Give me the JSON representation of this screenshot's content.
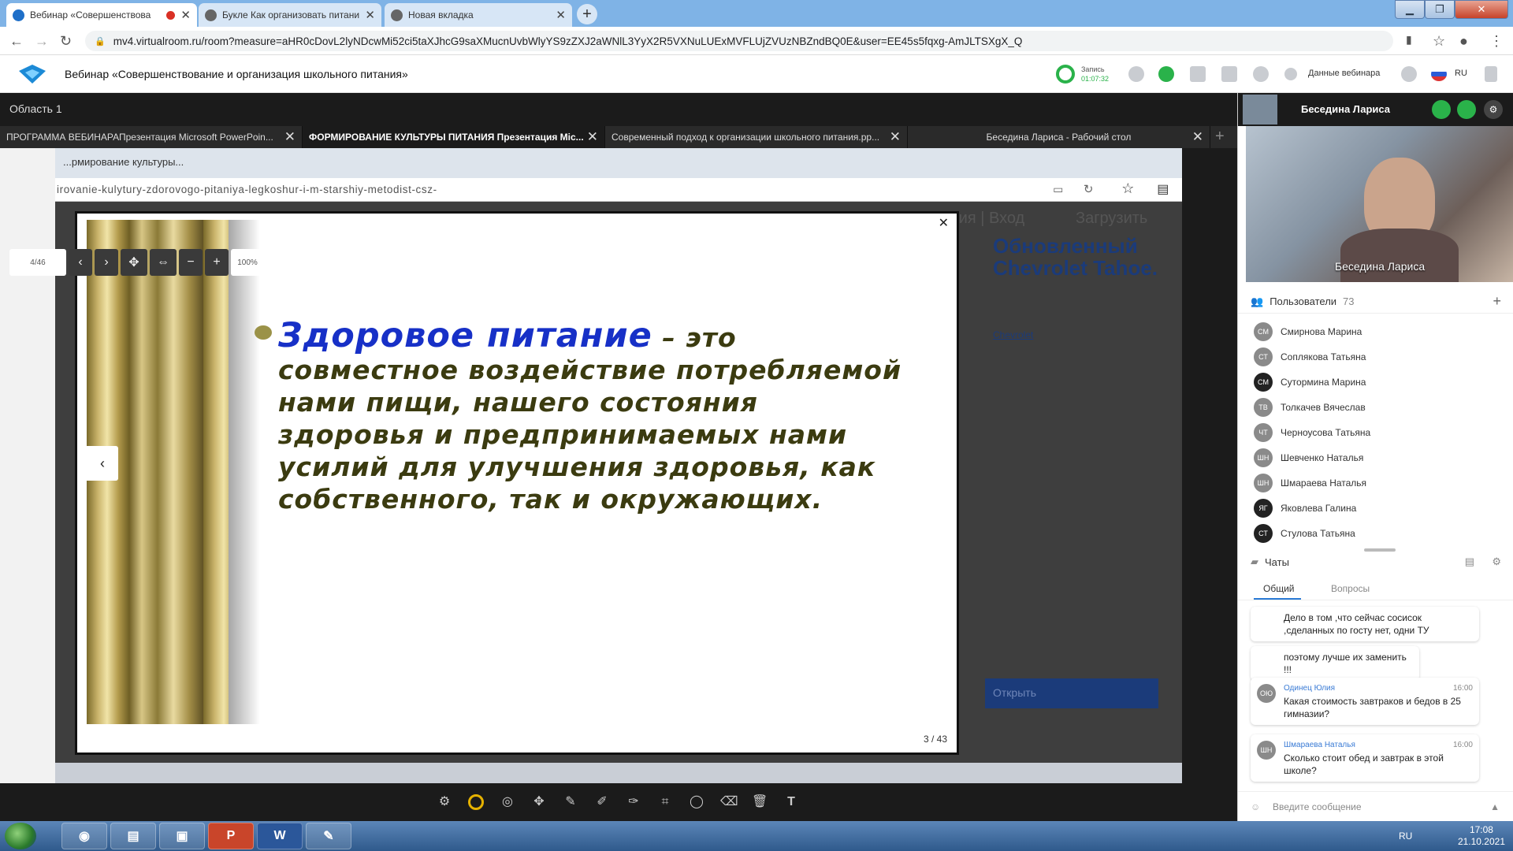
{
  "browser": {
    "tabs": [
      {
        "title": "Вебинар «Совершенствова",
        "recording": true
      },
      {
        "title": "Букле Как организовать питани"
      },
      {
        "title": "Новая вкладка"
      }
    ],
    "url": "mv4.virtualroom.ru/room?measure=aHR0cDovL2lyNDcwMi52ci5taXJhcG9saXMucnUvbWlyYS9zZXJ2aWNlL3YyX2R5VXNuLUExMVFLUjZVUzNBZndBQ0E&user=EE45s5fqxg-AmJLTSXgX_Q"
  },
  "app": {
    "title": "Вебинар «Совершенствование и организация школьного питания»",
    "record_label": "Запись",
    "record_time": "01:07:32",
    "webinar_data_label": "Данные вебинара",
    "lang": "RU"
  },
  "stage": {
    "region": "Область 1",
    "doc_tabs": [
      {
        "label": "ПРОГРАММА ВЕБИНАРАПрезентация Microsoft PowerPoin..."
      },
      {
        "label": "ФОРМИРОВАНИЕ КУЛЬТУРЫ ПИТАНИЯ Презентация Mic...",
        "active": true
      },
      {
        "label": "Современный подход к организации школьного питания.pp..."
      },
      {
        "label": "Беседина Лариса - Рабочий стол"
      }
    ],
    "page_counter": "4/46",
    "zoom": "100%",
    "inner_url": "irovanie-kulytury-zdorovogo-pitaniya-legkoshur-i-m-starshiy-metodist-csz-",
    "inner_tab_title": "...рмирование культуры...",
    "bg_site_text": "Обновленный Chevrolet Tahoe.",
    "bg_site_nav": "дия | Вход",
    "bg_site_upload": "Загрузить",
    "bg_link": "Chevrolet",
    "bg_open": "Открыть",
    "slide": {
      "title": "Здоровое питание",
      "dash": " – это",
      "body": "совместное воздействие потребляемой нами пищи, нашего состояния здоровья и предпринимаемых нами усилий для улучшения здоровья, как собственного, так и окружающих.",
      "page": "3 / 43"
    }
  },
  "presenter": {
    "name": "Беседина Лариса"
  },
  "users": {
    "label": "Пользователи",
    "count": "73",
    "list": [
      {
        "initials": "СМ",
        "name": "Смирнова Марина",
        "dark": false
      },
      {
        "initials": "СТ",
        "name": "Соплякова Татьяна",
        "dark": false
      },
      {
        "initials": "СМ",
        "name": "Сутормина Марина",
        "dark": true
      },
      {
        "initials": "ТВ",
        "name": "Толкачев Вячеслав",
        "dark": false
      },
      {
        "initials": "ЧТ",
        "name": "Черноусова Татьяна",
        "dark": false
      },
      {
        "initials": "ШН",
        "name": "Шевченко Наталья",
        "dark": false
      },
      {
        "initials": "ШН",
        "name": "Шмараева Наталья",
        "dark": false
      },
      {
        "initials": "ЯГ",
        "name": "Яковлева Галина",
        "dark": true
      },
      {
        "initials": "СТ",
        "name": "Стулова Татьяна",
        "dark": true
      }
    ]
  },
  "chat": {
    "label": "Чаты",
    "tab_general": "Общий",
    "tab_questions": "Вопросы",
    "messages": [
      {
        "text": "Дело в том ,что сейчас сосисок ,сделанных по госту нет, одни ТУ"
      },
      {
        "text": "поэтому лучше их заменить !!!"
      },
      {
        "initials": "ОЮ",
        "author": "Одинец Юлия",
        "time": "16:00",
        "text": "Какая стоимость завтраков и бедов в 25 гимназии?"
      },
      {
        "initials": "ШН",
        "author": "Шмараева Наталья",
        "time": "16:00",
        "text": "Сколько стоит обед и завтрак в этой школе?"
      }
    ],
    "input_placeholder": "Введите сообщение"
  },
  "taskbar": {
    "lang": "RU",
    "time": "17:08",
    "date": "21.10.2021"
  }
}
